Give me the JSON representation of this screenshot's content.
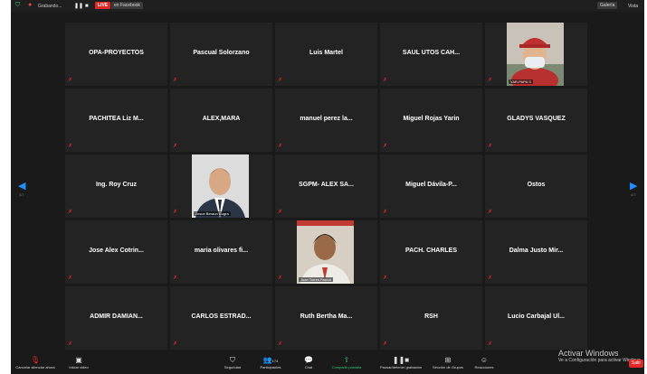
{
  "topbar": {
    "recording_title": "Grabando...",
    "live_badge": "LIVE",
    "live_platform": "en Facebook",
    "gallery_button": "Galería",
    "view_button": "Vista"
  },
  "nav": {
    "left_page": "4/7",
    "right_page": "4/7"
  },
  "participants": [
    {
      "name": "OPA-PROYECTOS"
    },
    {
      "name": "Pascual Solorzano"
    },
    {
      "name": "Luis Martel"
    },
    {
      "name": "SAUL UTOS CAH..."
    },
    {
      "name": "",
      "video": true,
      "video_label": "YAR-PAPA S"
    },
    {
      "name": "PACHITEA Liz M..."
    },
    {
      "name": "ALEX,MARA"
    },
    {
      "name": "manuel perez la..."
    },
    {
      "name": "Miguel Rojas Yarin"
    },
    {
      "name": "GLADYS VASQUEZ"
    },
    {
      "name": "Ing. Roy Cruz"
    },
    {
      "name": "",
      "video": true,
      "video_label": "Josue Beraun Cugra"
    },
    {
      "name": "SGPM- ALEX SA..."
    },
    {
      "name": "Miguel Dávila-P..."
    },
    {
      "name": "Ostos"
    },
    {
      "name": "Jose Alex Cotrin..."
    },
    {
      "name": "maria olivares fi..."
    },
    {
      "name": "",
      "video": true,
      "video_label": "Juan Torres Falcon"
    },
    {
      "name": "PACH. CHARLES"
    },
    {
      "name": "Dalma Justo Mir..."
    },
    {
      "name": "ADMIR DAMIAN..."
    },
    {
      "name": "CARLOS ESTRAD..."
    },
    {
      "name": "Ruth Bertha Ma..."
    },
    {
      "name": "RSH"
    },
    {
      "name": "Lucio Carbajal Ul..."
    }
  ],
  "toolbar": {
    "unmute": "Cancelar silenciar ahora",
    "start_video": "Iniciar video",
    "security": "Seguridad",
    "participants": "Participantes",
    "participants_count": "174",
    "chat": "Chat",
    "share": "Compartir pantalla",
    "pause_recording": "Pausar/detener grabación",
    "rooms": "Sección de Grupos",
    "reactions": "Reacciones",
    "leave": "Salir"
  },
  "watermark": {
    "line1": "Activar Windows",
    "line2": "Ve a Configuración para activar Windows."
  },
  "colors": {
    "live": "#e02828",
    "nav_arrow": "#1e90ff",
    "share_green": "#2ecc71",
    "mic_muted": "#e02828"
  }
}
